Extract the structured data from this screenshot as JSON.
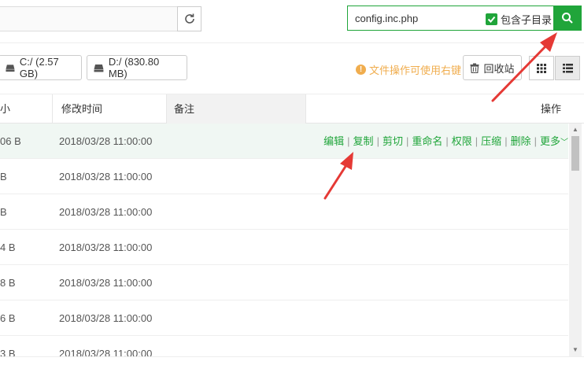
{
  "search": {
    "value": "config.inc.php",
    "include_subdir_label": "包含子目录",
    "include_subdir_checked": true
  },
  "disks": [
    {
      "label": "C:/ (2.57 GB)"
    },
    {
      "label": "D:/ (830.80 MB)"
    }
  ],
  "toolbar": {
    "tip": "文件操作可使用右键",
    "recycle_label": "回收站"
  },
  "table": {
    "columns": {
      "size": "小",
      "modified": "修改时间",
      "note": "备注",
      "actions": "操作"
    },
    "rows": [
      {
        "size": "06 B",
        "modified": "2018/03/28 11:00:00",
        "highlighted": true
      },
      {
        "size": "B",
        "modified": "2018/03/28 11:00:00"
      },
      {
        "size": "B",
        "modified": "2018/03/28 11:00:00"
      },
      {
        "size": "4 B",
        "modified": "2018/03/28 11:00:00"
      },
      {
        "size": "8 B",
        "modified": "2018/03/28 11:00:00"
      },
      {
        "size": "6 B",
        "modified": "2018/03/28 11:00:00"
      },
      {
        "size": "3 B",
        "modified": "2018/03/28 11:00:00"
      }
    ],
    "row_actions": [
      "编辑",
      "复制",
      "剪切",
      "重命名",
      "权限",
      "压缩",
      "删除",
      "更多"
    ]
  },
  "colors": {
    "accent": "#20a53a",
    "annotation": "#e53935",
    "tip": "#f0ad4e"
  }
}
